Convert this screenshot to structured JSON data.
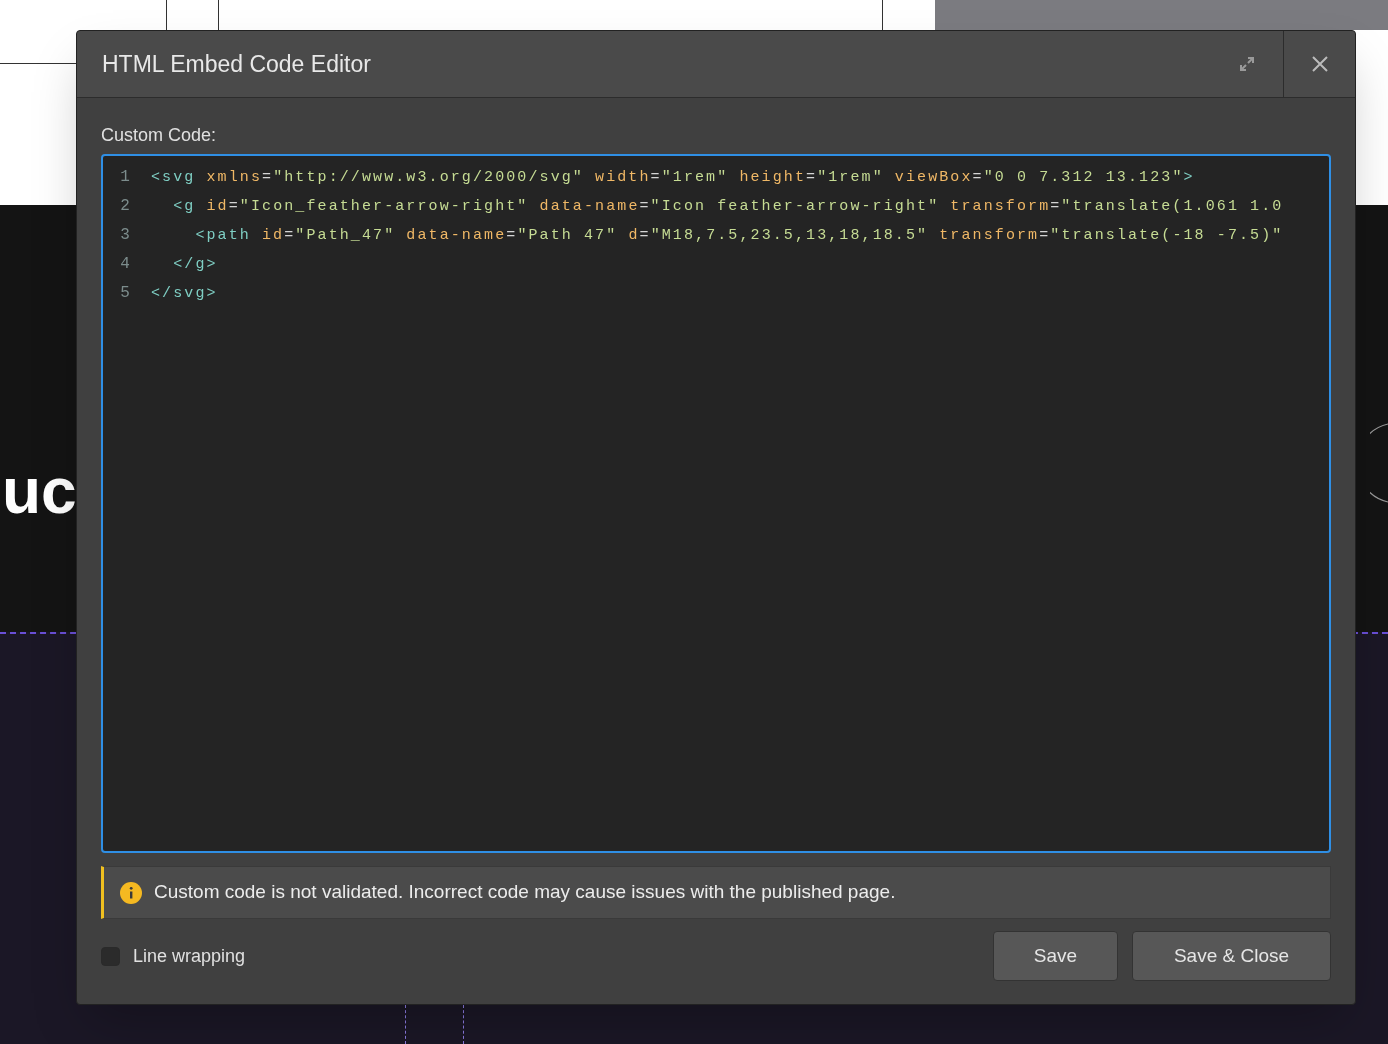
{
  "background": {
    "heading_fragment": "uc"
  },
  "dialog": {
    "title": "HTML Embed Code Editor",
    "field_label": "Custom Code:",
    "code_lines": [
      {
        "number": "1",
        "tokens": [
          {
            "kind": "tag",
            "text": "<svg"
          },
          {
            "kind": "attr",
            "text": " xmlns"
          },
          {
            "kind": "punct",
            "text": "="
          },
          {
            "kind": "value",
            "text": "\"http://www.w3.org/2000/svg\""
          },
          {
            "kind": "attr",
            "text": " width"
          },
          {
            "kind": "punct",
            "text": "="
          },
          {
            "kind": "value",
            "text": "\"1rem\""
          },
          {
            "kind": "attr",
            "text": " height"
          },
          {
            "kind": "punct",
            "text": "="
          },
          {
            "kind": "value",
            "text": "\"1rem\""
          },
          {
            "kind": "attr",
            "text": " viewBox"
          },
          {
            "kind": "punct",
            "text": "="
          },
          {
            "kind": "value",
            "text": "\"0 0 7.312 13.123\""
          },
          {
            "kind": "tag",
            "text": ">"
          }
        ]
      },
      {
        "number": "2",
        "tokens": [
          {
            "kind": "tag",
            "text": "  <g"
          },
          {
            "kind": "attr",
            "text": " id"
          },
          {
            "kind": "punct",
            "text": "="
          },
          {
            "kind": "value",
            "text": "\"Icon_feather-arrow-right\""
          },
          {
            "kind": "attr",
            "text": " data-name"
          },
          {
            "kind": "punct",
            "text": "="
          },
          {
            "kind": "value",
            "text": "\"Icon feather-arrow-right\""
          },
          {
            "kind": "attr",
            "text": " transform"
          },
          {
            "kind": "punct",
            "text": "="
          },
          {
            "kind": "value",
            "text": "\"translate(1.061 1.0"
          }
        ]
      },
      {
        "number": "3",
        "tokens": [
          {
            "kind": "tag",
            "text": "    <path"
          },
          {
            "kind": "attr",
            "text": " id"
          },
          {
            "kind": "punct",
            "text": "="
          },
          {
            "kind": "value",
            "text": "\"Path_47\""
          },
          {
            "kind": "attr",
            "text": " data-name"
          },
          {
            "kind": "punct",
            "text": "="
          },
          {
            "kind": "value",
            "text": "\"Path 47\""
          },
          {
            "kind": "attr",
            "text": " d"
          },
          {
            "kind": "punct",
            "text": "="
          },
          {
            "kind": "value",
            "text": "\"M18,7.5,23.5,13,18,18.5\""
          },
          {
            "kind": "attr",
            "text": " transform"
          },
          {
            "kind": "punct",
            "text": "="
          },
          {
            "kind": "value",
            "text": "\"translate(-18 -7.5)\""
          }
        ]
      },
      {
        "number": "4",
        "tokens": [
          {
            "kind": "tag",
            "text": "  </g>"
          }
        ]
      },
      {
        "number": "5",
        "tokens": [
          {
            "kind": "tag",
            "text": "</svg>"
          }
        ]
      }
    ],
    "warning": "Custom code is not validated. Incorrect code may cause issues with the published page.",
    "line_wrapping": {
      "label": "Line wrapping",
      "checked": false
    },
    "buttons": [
      {
        "label": "Save"
      },
      {
        "label": "Save & Close"
      }
    ]
  }
}
